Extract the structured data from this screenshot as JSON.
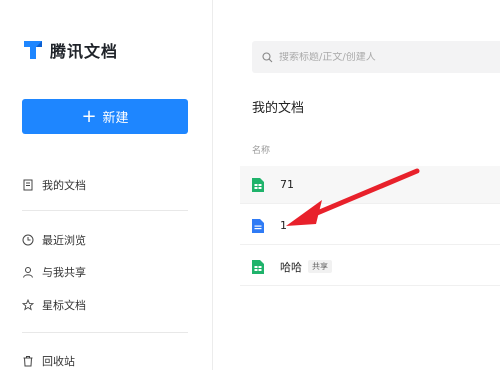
{
  "sidebar": {
    "brand": "腾讯文档",
    "new_button": "新建",
    "nav": [
      {
        "label": "我的文档",
        "icon": "document-icon"
      },
      {
        "label": "最近浏览",
        "icon": "clock-icon"
      },
      {
        "label": "与我共享",
        "icon": "user-icon"
      },
      {
        "label": "星标文档",
        "icon": "star-icon"
      },
      {
        "label": "回收站",
        "icon": "trash-icon"
      }
    ]
  },
  "main": {
    "search_placeholder": "搜索标题/正文/创建人",
    "section_title": "我的文档",
    "column_name": "名称",
    "files": [
      {
        "name": "71",
        "type": "sheet",
        "tag": ""
      },
      {
        "name": "1",
        "type": "doc",
        "tag": ""
      },
      {
        "name": "哈哈",
        "type": "sheet",
        "tag": "共享"
      }
    ]
  },
  "colors": {
    "accent": "#1e86ff",
    "sheet": "#1fb36b",
    "doc": "#2f7bf5",
    "annotation": "#e8212b"
  }
}
